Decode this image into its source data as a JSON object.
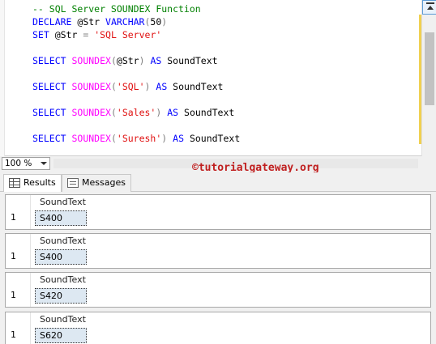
{
  "editor": {
    "lines": [
      [
        {
          "t": "-- SQL Server SOUNDEX Function",
          "c": "cm"
        }
      ],
      [
        {
          "t": "DECLARE",
          "c": "kw"
        },
        {
          "t": " @Str ",
          "c": "pl"
        },
        {
          "t": "VARCHAR",
          "c": "kw"
        },
        {
          "t": "(",
          "c": "op"
        },
        {
          "t": "50",
          "c": "pl"
        },
        {
          "t": ")",
          "c": "op"
        }
      ],
      [
        {
          "t": "SET",
          "c": "kw"
        },
        {
          "t": " @Str ",
          "c": "pl"
        },
        {
          "t": "=",
          "c": "op"
        },
        {
          "t": " ",
          "c": "pl"
        },
        {
          "t": "'SQL Server'",
          "c": "str"
        }
      ],
      [],
      [
        {
          "t": "SELECT",
          "c": "kw"
        },
        {
          "t": " ",
          "c": "pl"
        },
        {
          "t": "SOUNDEX",
          "c": "fn"
        },
        {
          "t": "(",
          "c": "op"
        },
        {
          "t": "@Str",
          "c": "pl"
        },
        {
          "t": ")",
          "c": "op"
        },
        {
          "t": " ",
          "c": "pl"
        },
        {
          "t": "AS",
          "c": "kw"
        },
        {
          "t": " SoundText",
          "c": "pl"
        }
      ],
      [],
      [
        {
          "t": "SELECT",
          "c": "kw"
        },
        {
          "t": " ",
          "c": "pl"
        },
        {
          "t": "SOUNDEX",
          "c": "fn"
        },
        {
          "t": "(",
          "c": "op"
        },
        {
          "t": "'SQL'",
          "c": "str"
        },
        {
          "t": ")",
          "c": "op"
        },
        {
          "t": " ",
          "c": "pl"
        },
        {
          "t": "AS",
          "c": "kw"
        },
        {
          "t": " SoundText",
          "c": "pl"
        }
      ],
      [],
      [
        {
          "t": "SELECT",
          "c": "kw"
        },
        {
          "t": " ",
          "c": "pl"
        },
        {
          "t": "SOUNDEX",
          "c": "fn"
        },
        {
          "t": "(",
          "c": "op"
        },
        {
          "t": "'Sales'",
          "c": "str"
        },
        {
          "t": ")",
          "c": "op"
        },
        {
          "t": " ",
          "c": "pl"
        },
        {
          "t": "AS",
          "c": "kw"
        },
        {
          "t": " SoundText",
          "c": "pl"
        }
      ],
      [],
      [
        {
          "t": "SELECT",
          "c": "kw"
        },
        {
          "t": " ",
          "c": "pl"
        },
        {
          "t": "SOUNDEX",
          "c": "fn"
        },
        {
          "t": "(",
          "c": "op"
        },
        {
          "t": "'Suresh'",
          "c": "str"
        },
        {
          "t": ")",
          "c": "op"
        },
        {
          "t": " ",
          "c": "pl"
        },
        {
          "t": "AS",
          "c": "kw"
        },
        {
          "t": " SoundText",
          "c": "pl"
        }
      ]
    ]
  },
  "zoom": {
    "value": "100 %"
  },
  "watermark": "©tutorialgateway.org",
  "tabs": {
    "results": "Results",
    "messages": "Messages"
  },
  "results": [
    {
      "header": "SoundText",
      "row": "1",
      "value": "S400"
    },
    {
      "header": "SoundText",
      "row": "1",
      "value": "S400"
    },
    {
      "header": "SoundText",
      "row": "1",
      "value": "S420"
    },
    {
      "header": "SoundText",
      "row": "1",
      "value": "S620"
    }
  ]
}
